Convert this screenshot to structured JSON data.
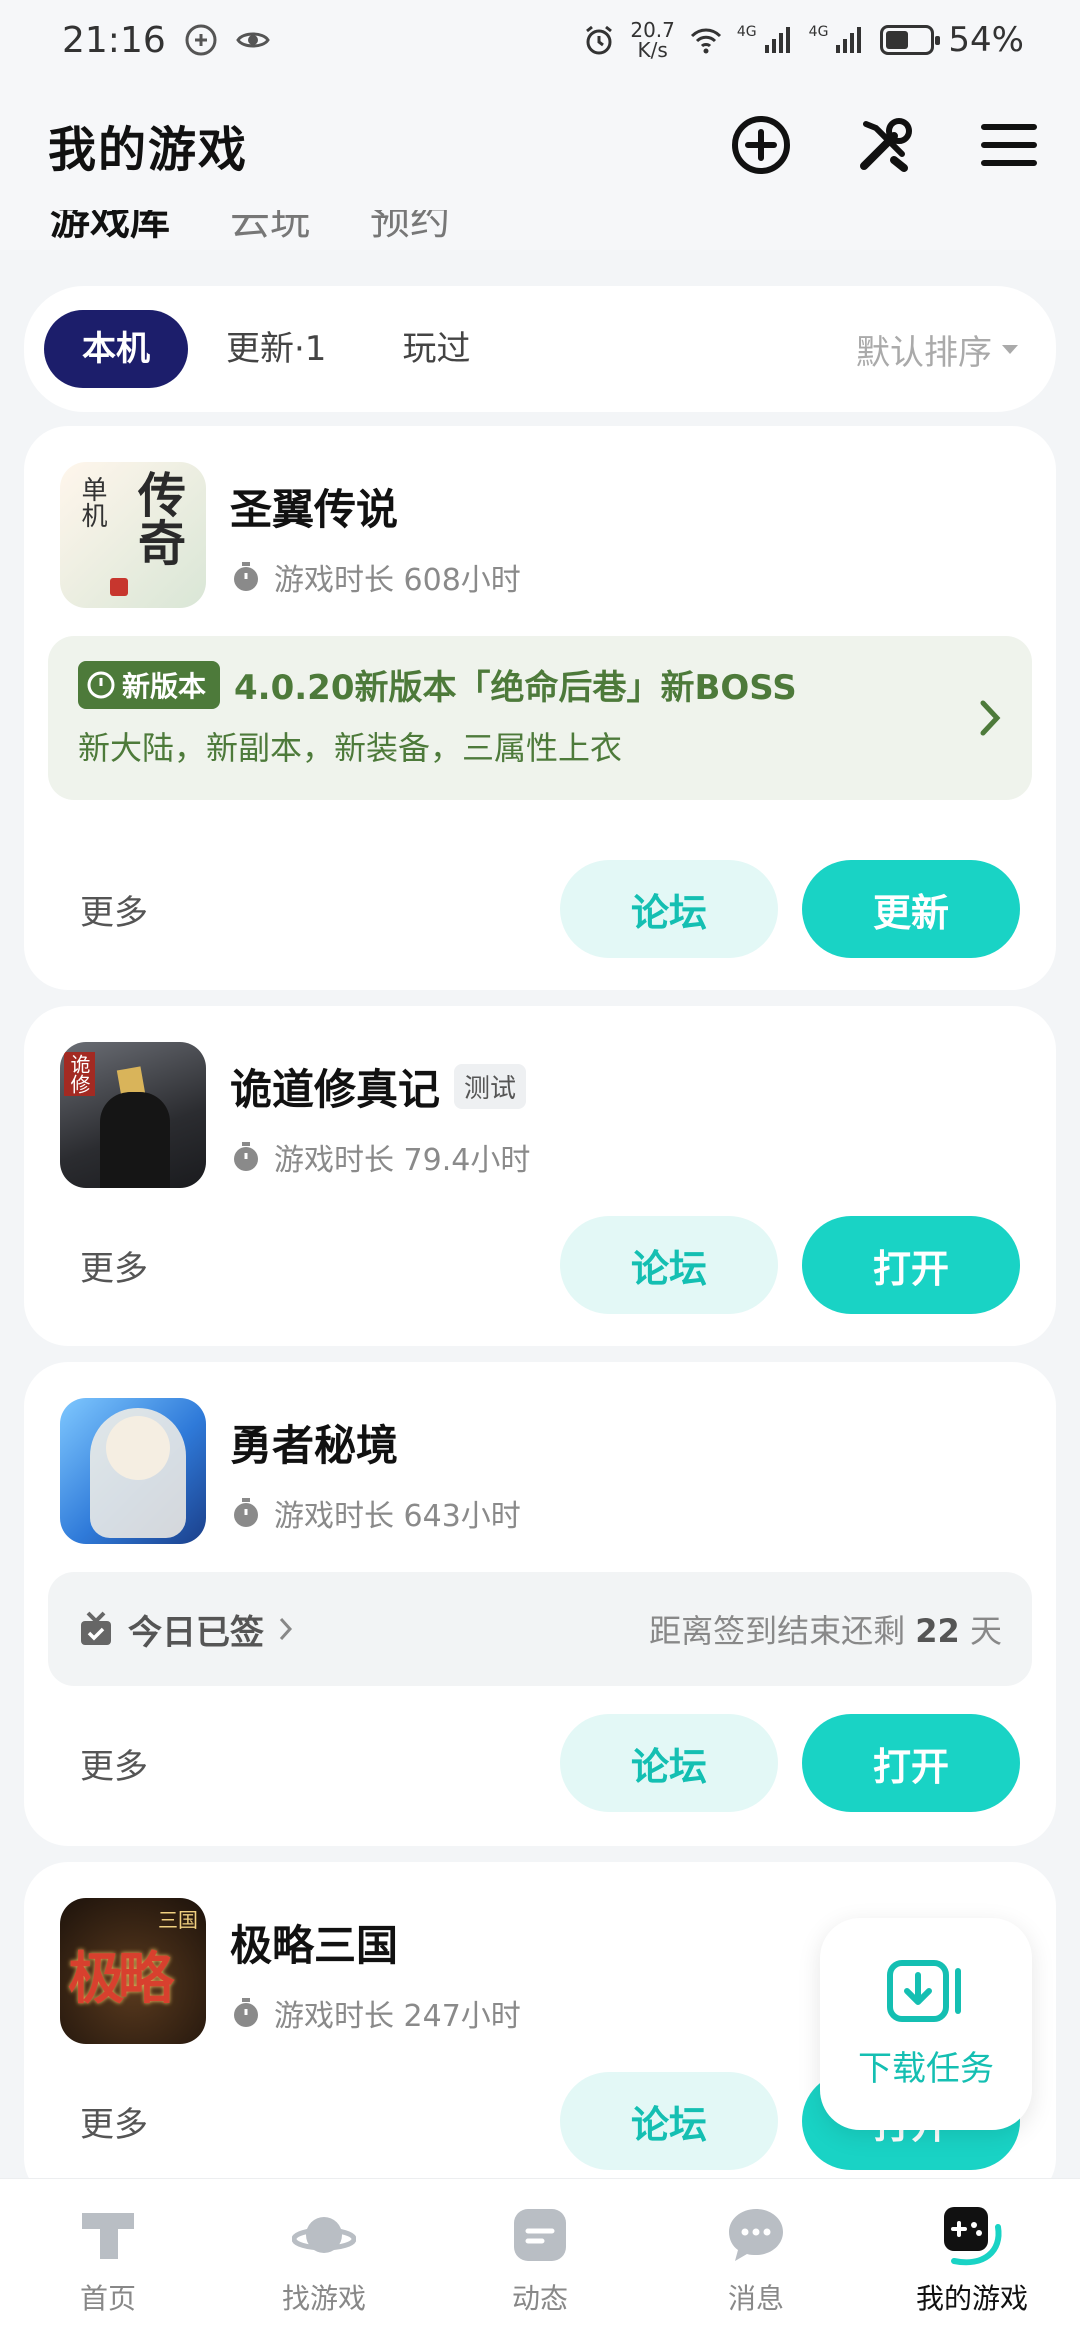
{
  "status_bar": {
    "time": "21:16",
    "net_speed_value": "20.7",
    "net_speed_unit": "K/s",
    "net_label_1": "4G",
    "net_label_2": "4G",
    "battery": "54%"
  },
  "header": {
    "title": "我的游戏",
    "icons": [
      "add-circle-icon",
      "tools-icon",
      "menu-icon"
    ]
  },
  "top_tabs": [
    {
      "label": "游戏库",
      "active": true
    },
    {
      "label": "云玩",
      "active": false
    },
    {
      "label": "预约",
      "active": false
    }
  ],
  "filter": {
    "chips": [
      "本机",
      "更新·1",
      "玩过"
    ],
    "active_index": 0,
    "sort_label": "默认排序"
  },
  "games": [
    {
      "name": "圣翼传说",
      "badge": "",
      "playtime": "游戏时长 608小时",
      "icon_text_1": "单机",
      "icon_text_2": "传奇",
      "update": {
        "badge_label": "新版本",
        "title": "4.0.20新版本「绝命后巷」新BOSS",
        "desc": "新大陆，新副本，新装备，三属性上衣"
      },
      "more": "更多",
      "forum": "论坛",
      "primary": "更新"
    },
    {
      "name": "诡道修真记",
      "badge": "测试",
      "playtime": "游戏时长 79.4小时",
      "icon_text_1": "诡修",
      "more": "更多",
      "forum": "论坛",
      "primary": "打开"
    },
    {
      "name": "勇者秘境",
      "badge": "",
      "playtime": "游戏时长 643小时",
      "sign": {
        "left": "今日已签",
        "right_prefix": "距离签到结束还剩",
        "days": "22",
        "right_suffix": "天"
      },
      "more": "更多",
      "forum": "论坛",
      "primary": "打开"
    },
    {
      "name": "极略三国",
      "badge": "",
      "playtime": "游戏时长 247小时",
      "icon_text_1": "极略",
      "icon_text_2": "三国",
      "more": "更多",
      "forum": "论坛",
      "primary": "打开"
    }
  ],
  "fab": {
    "label": "下载任务"
  },
  "bottom_nav": [
    {
      "label": "首页",
      "icon": "home-icon",
      "active": false
    },
    {
      "label": "找游戏",
      "icon": "planet-icon",
      "active": false
    },
    {
      "label": "动态",
      "icon": "feed-icon",
      "active": false
    },
    {
      "label": "消息",
      "icon": "message-icon",
      "active": false
    },
    {
      "label": "我的游戏",
      "icon": "gamepad-icon",
      "active": true
    }
  ],
  "colors": {
    "accent": "#19d3c5",
    "accent_text": "#14bfb2",
    "chip_active": "#1c1e6b",
    "update_green": "#4d7a3a"
  }
}
